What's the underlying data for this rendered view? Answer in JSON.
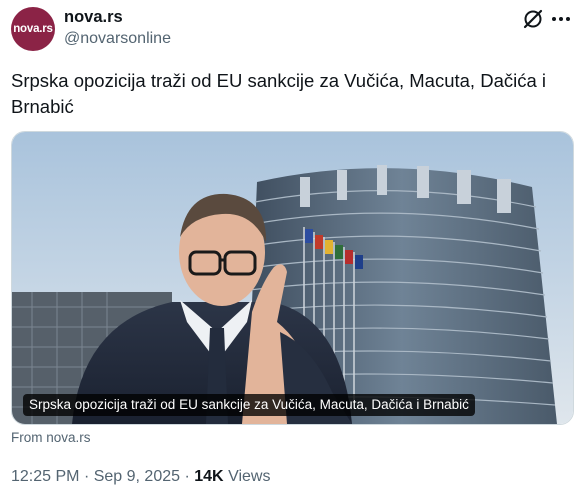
{
  "account": {
    "avatar_text": "nova.rs",
    "avatar_color": "#8b2346",
    "display_name": "nova.rs",
    "handle": "@novarsonline",
    "logo_icon": "x-logo-icon",
    "menu_icon": "more-options-icon"
  },
  "tweet": {
    "text": "Srpska opozicija traži od EU sankcije za Vučića, Macuta, Dačića i Brnabić"
  },
  "card": {
    "image_caption": "Srpska opozicija traži od EU sankcije za Vučića, Macuta, Dačića i Brnabić",
    "source": "From nova.rs"
  },
  "meta": {
    "time": "12:25 PM",
    "separator": "·",
    "date": "Sep 9, 2025",
    "views_count": "14K",
    "views_label": "Views"
  }
}
